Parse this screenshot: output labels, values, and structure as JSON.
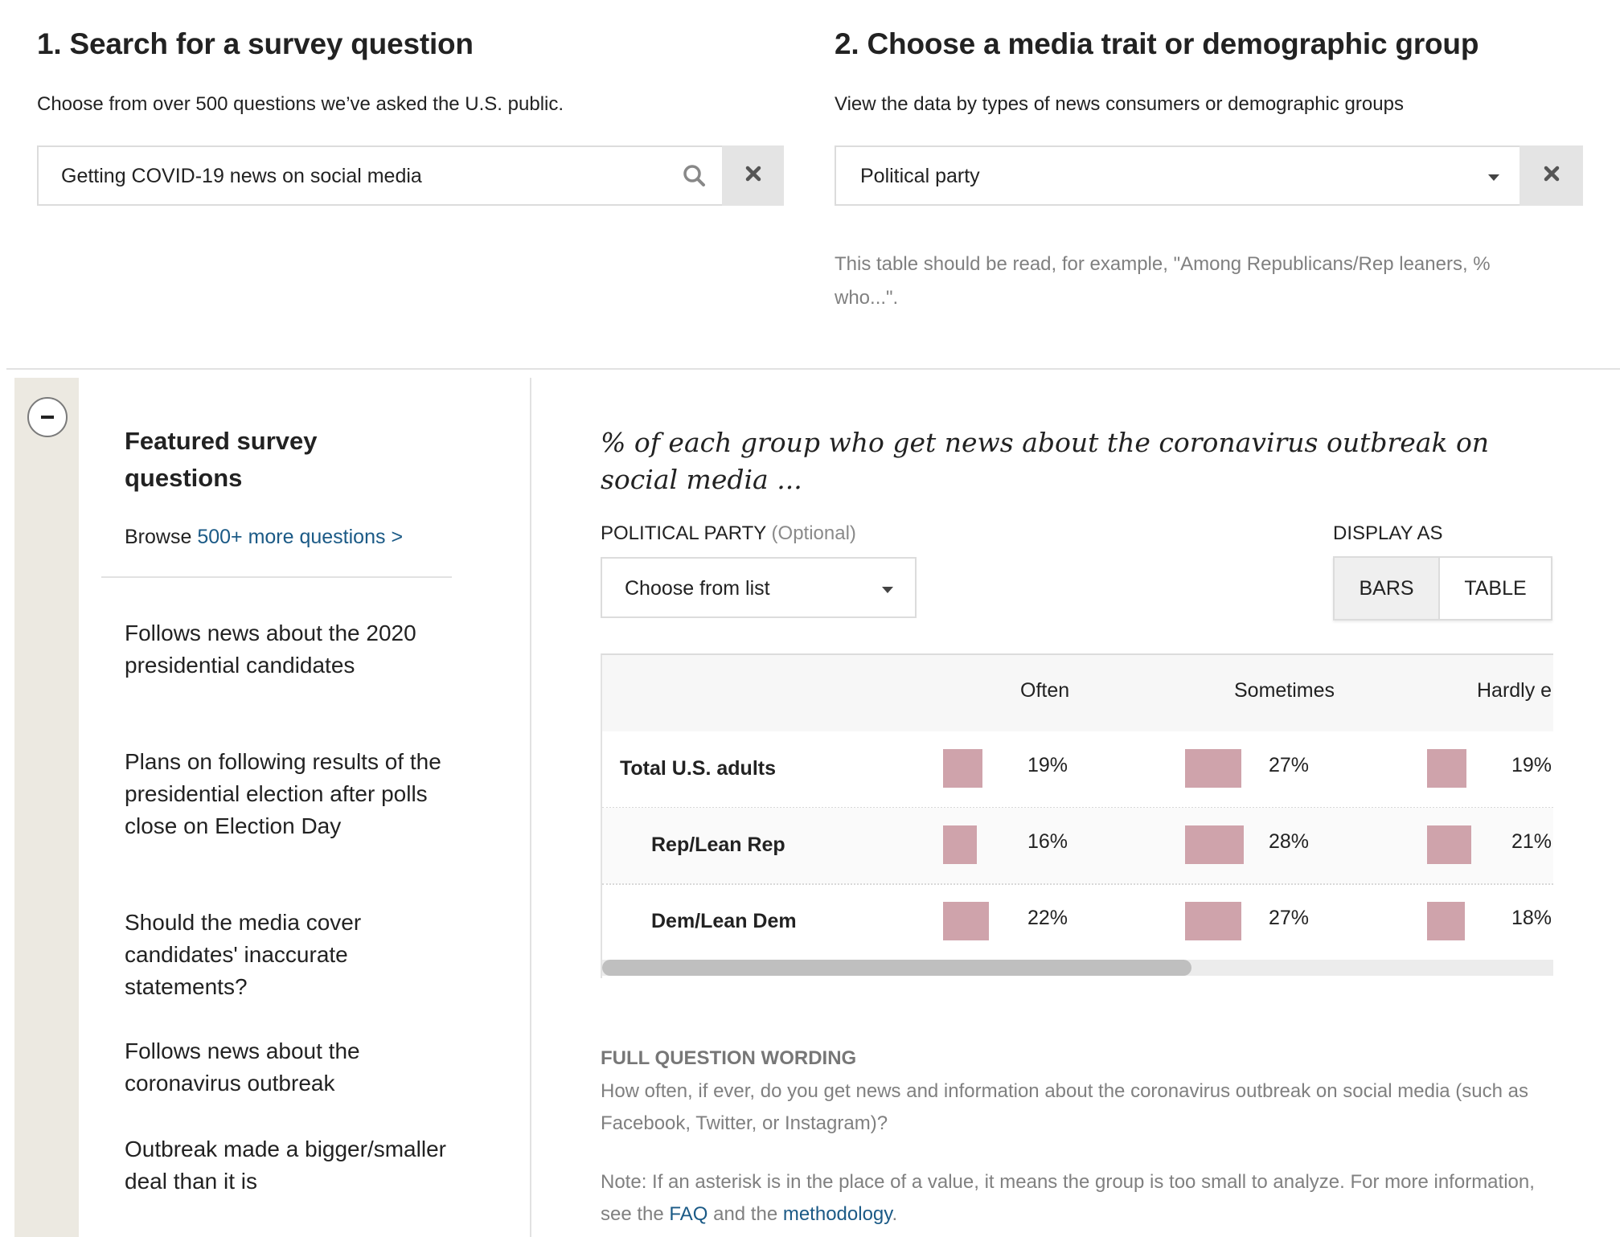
{
  "step1": {
    "title": "1. Search for a survey question",
    "subtitle": "Choose from over 500 questions we’ve asked the U.S. public.",
    "search_value": "Getting COVID-19 news on social media",
    "search_icon": "search-icon",
    "clear_icon": "close-icon"
  },
  "step2": {
    "title": "2. Choose a media trait or demographic group",
    "subtitle": "View the data by types of news consumers or demographic groups",
    "selected_group": "Political party",
    "dropdown_icon": "chevron-down-icon",
    "clear_icon": "close-icon",
    "hint_line1": "This table should be read, for example, \"Among Republicans/Rep leaners, %",
    "hint_line2": "who...\"."
  },
  "sidebar": {
    "collapse_icon": "minus-icon",
    "featured_title": "Featured survey questions",
    "browse_prefix": "Browse ",
    "browse_link": "500+ more questions >",
    "items": [
      {
        "label": "Follows news about the 2020 presidential candidates"
      },
      {
        "label": "Plans on following results of the presidential election after polls close on Election Day"
      },
      {
        "label": "Should the media cover candidates' inaccurate statements?"
      },
      {
        "label": "Follows news about the coronavirus outbreak"
      },
      {
        "label": "Outbreak made a bigger/smaller deal than it is"
      }
    ]
  },
  "main": {
    "chart_title": "% of each group who get news about the coronavirus outbreak on social media ...",
    "filter_label": "POLITICAL PARTY",
    "filter_optional": "(Optional)",
    "filter_value": "Choose from list",
    "display_label": "DISPLAY AS",
    "display_options": [
      {
        "label": "BARS",
        "active": true
      },
      {
        "label": "TABLE",
        "active": false
      }
    ],
    "scroll_position_fraction": 0.62,
    "full_question_title": "FULL QUESTION WORDING",
    "full_question_text": "How often, if ever, do you get news and information about the coronavirus outbreak on social media (such as Facebook, Twitter, or Instagram)?",
    "note_prefix": "Note: If an asterisk is in the place of a value, it means the group is too small to analyze. For more information, see the ",
    "note_link1": "FAQ",
    "note_mid": " and the ",
    "note_link2": "methodology",
    "note_suffix": "."
  },
  "colors": {
    "bar": "#cfa3ab",
    "link": "#1b5a86",
    "sidebar_strip": "#ece9e1"
  },
  "chart_data": {
    "type": "table",
    "title": "% of each group who get news about the coronavirus outbreak on social media ...",
    "columns": [
      "Often",
      "Sometimes",
      "Hardly e"
    ],
    "rows": [
      {
        "label": "Total U.S. adults",
        "values": [
          19,
          27,
          19
        ],
        "display": [
          "19%",
          "27%",
          "19%"
        ],
        "indent": false
      },
      {
        "label": "Rep/Lean Rep",
        "values": [
          16,
          28,
          21
        ],
        "display": [
          "16%",
          "28%",
          "21%"
        ],
        "indent": true
      },
      {
        "label": "Dem/Lean Dem",
        "values": [
          22,
          27,
          18
        ],
        "display": [
          "22%",
          "27%",
          "18%"
        ],
        "indent": true
      }
    ],
    "unit": "%"
  }
}
